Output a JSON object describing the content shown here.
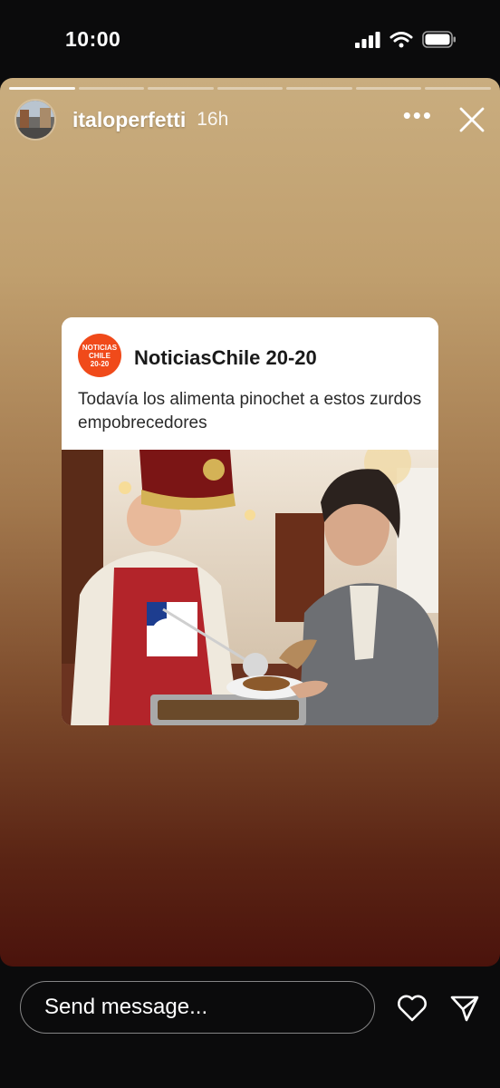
{
  "status_bar": {
    "time": "10:00"
  },
  "story": {
    "progress_segments": 7,
    "active_segment": 1,
    "username": "italoperfetti",
    "time_ago": "16h"
  },
  "post": {
    "logo_text": "NOTICIAS\nCHILE\n20-20",
    "source_name": "NoticiasChile 20-20",
    "text": "Todavía los alimenta pinochet  a estos zurdos empobrecedores"
  },
  "message_bar": {
    "placeholder": "Send message..."
  },
  "colors": {
    "logo": "#f04a1a",
    "background": "#0b0b0c"
  },
  "icons": [
    "signal-icon",
    "wifi-icon",
    "battery-icon",
    "more-icon",
    "close-icon",
    "heart-icon",
    "send-icon"
  ]
}
